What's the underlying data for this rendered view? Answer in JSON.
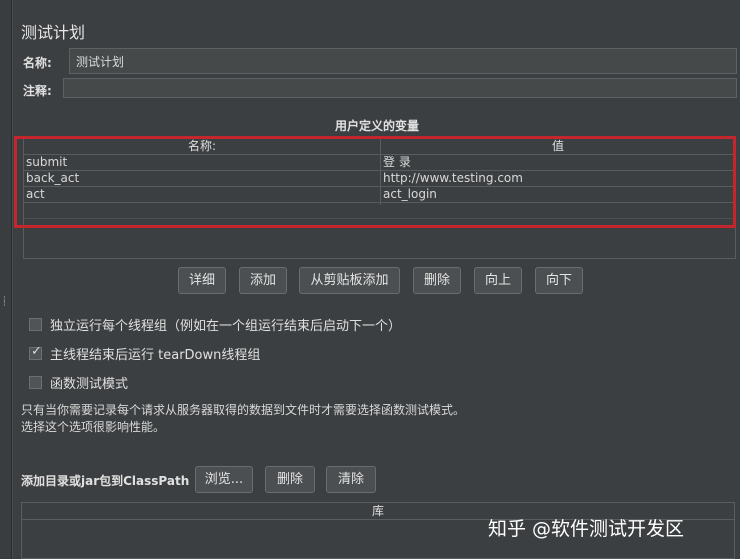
{
  "panel_title": "测试计划",
  "name_label": "名称:",
  "name_value": "测试计划",
  "comment_label": "注释:",
  "comment_value": "",
  "variables_section_title": "用户定义的变量",
  "variables_table": {
    "headers": [
      "名称:",
      "值"
    ],
    "rows": [
      {
        "name": "submit",
        "value": "登 录"
      },
      {
        "name": "back_act",
        "value": "http://www.testing.com"
      },
      {
        "name": "act",
        "value": "act_login"
      }
    ]
  },
  "table_buttons": [
    "详细",
    "添加",
    "从剪贴板添加",
    "删除",
    "向上",
    "向下"
  ],
  "options": [
    {
      "label": "独立运行每个线程组（例如在一个组运行结束后启动下一个）",
      "checked": false
    },
    {
      "label": "主线程结束后运行 tearDown线程组",
      "checked": true
    },
    {
      "label": "函数测试模式",
      "checked": false
    }
  ],
  "functional_note_line1": "只有当你需要记录每个请求从服务器取得的数据到文件时才需要选择函数测试模式。",
  "functional_note_line2": "选择这个选项很影响性能。",
  "classpath_label": "添加目录或jar包到ClassPath",
  "classpath_buttons": {
    "browse": "浏览...",
    "delete": "删除",
    "clear": "清除"
  },
  "library_header": "库",
  "watermark_text": "知乎 @软件测试开发区",
  "colors": {
    "background": "#3c3f41",
    "highlight": "#c4262e"
  }
}
